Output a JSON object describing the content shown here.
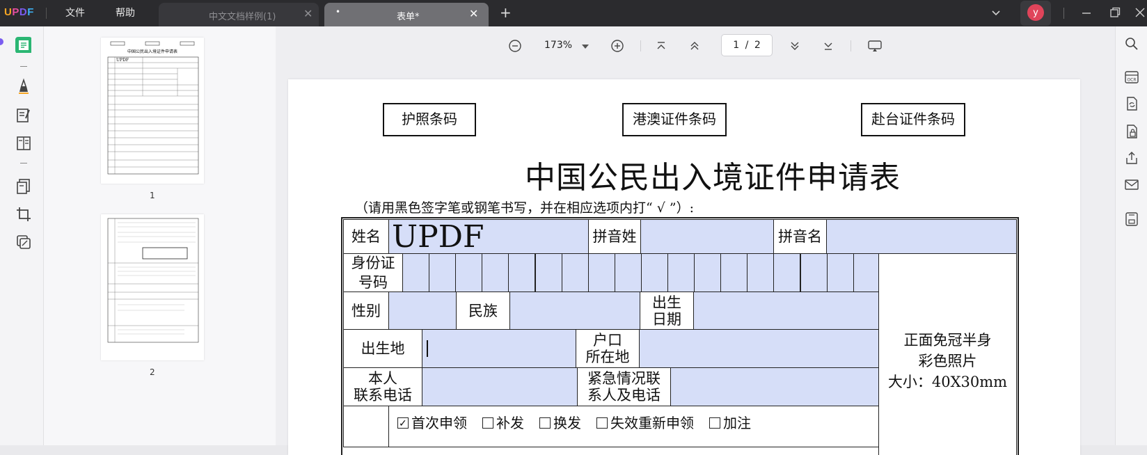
{
  "app": {
    "logo": "UPDF",
    "menu_file": "文件",
    "menu_help": "帮助"
  },
  "tabs": [
    {
      "label": "中文文档样例(1)",
      "close": "✕"
    },
    {
      "label": "表单*",
      "close": "✕",
      "dot": "•"
    }
  ],
  "user": {
    "initial": "y"
  },
  "thumbnails": [
    {
      "number": "1"
    },
    {
      "number": "2"
    }
  ],
  "thumb1": {
    "title": "中国公民出入境证件申请表",
    "name": "UPDF"
  },
  "toolbar": {
    "zoom": "173%",
    "page_current": "1",
    "page_sep": "/",
    "page_total": "2"
  },
  "document": {
    "barcodes": [
      "护照条码",
      "港澳证件条码",
      "赴台证件条码"
    ],
    "title": "中国公民出入境证件申请表",
    "instruction": "（请用黑色签字笔或钢笔书写，并在相应选项内打“ √ ”）:",
    "form": {
      "name_label": "姓名",
      "name_value": "UPDF",
      "pinyin_surname_label": "拼音姓",
      "pinyin_givenname_label": "拼音名",
      "id_label": "身份证\n号码",
      "gender_label": "性别",
      "ethnicity_label": "民族",
      "birthdate_label": "出生\n日期",
      "photo_label": "正面免冠半身\n彩色照片\n大小：40X30mm",
      "birthplace_label": "出生地",
      "household_label": "户口\n所在地",
      "phone_label": "本人\n联系电话",
      "emergency_label": "紧急情况联\n系人及电话",
      "options": [
        "首次申领",
        "补发",
        "换发",
        "失效重新申领",
        "加注"
      ]
    }
  }
}
